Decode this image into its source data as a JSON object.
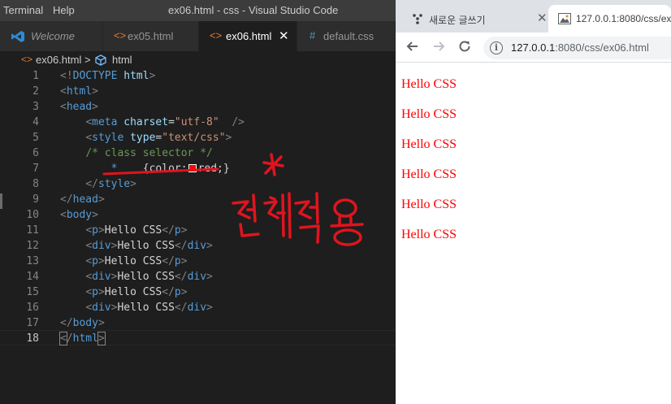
{
  "vscode": {
    "menu": [
      "Terminal",
      "Help"
    ],
    "window_title": "ex06.html - css - Visual Studio Code",
    "tabs": [
      {
        "label": "Welcome",
        "icon": "vscode-logo-icon"
      },
      {
        "label": "ex05.html",
        "icon": "html-file-icon"
      },
      {
        "label": "ex06.html",
        "icon": "html-file-icon",
        "active": true
      },
      {
        "label": "default.css",
        "icon": "css-file-icon"
      }
    ],
    "close_glyph": "✕",
    "breadcrumb": {
      "file": "ex06.html",
      "symbol": "html"
    },
    "line_numbers": [
      "1",
      "2",
      "3",
      "4",
      "5",
      "6",
      "7",
      "8",
      "9",
      "10",
      "11",
      "12",
      "13",
      "14",
      "15",
      "16",
      "17",
      "18"
    ],
    "code": {
      "l1": {
        "a": "<!",
        "b": "DOCTYPE ",
        "c": "html",
        "d": ">"
      },
      "tag_html": "html",
      "tag_head": "head",
      "tag_meta": "meta",
      "attr_charset": "charset",
      "val_charset": "\"utf-8\"",
      "tag_style": "style",
      "attr_type": "type",
      "val_type": "\"text/css\"",
      "comment": "/* class selector */",
      "selector": "*",
      "prop": "{color:",
      "value": "red;}",
      "tag_body": "body",
      "tag_p": "p",
      "tag_div": "div",
      "text": "Hello CSS"
    },
    "annotation": {
      "mark": "*",
      "handwriting": "전체적용",
      "color": "#e0141e"
    }
  },
  "browser": {
    "tabs": [
      {
        "label": "새로운 글쓰기",
        "icon": "app-icon"
      },
      {
        "label": "127.0.0.1:8080/css/ex",
        "icon": "page-favicon-icon"
      }
    ],
    "url_host": "127.0.0.1",
    "url_rest": ":8080/css/ex06.html",
    "page_lines": [
      "Hello CSS",
      "Hello CSS",
      "Hello CSS",
      "Hello CSS",
      "Hello CSS",
      "Hello CSS"
    ],
    "text_color": "#ff0000"
  }
}
